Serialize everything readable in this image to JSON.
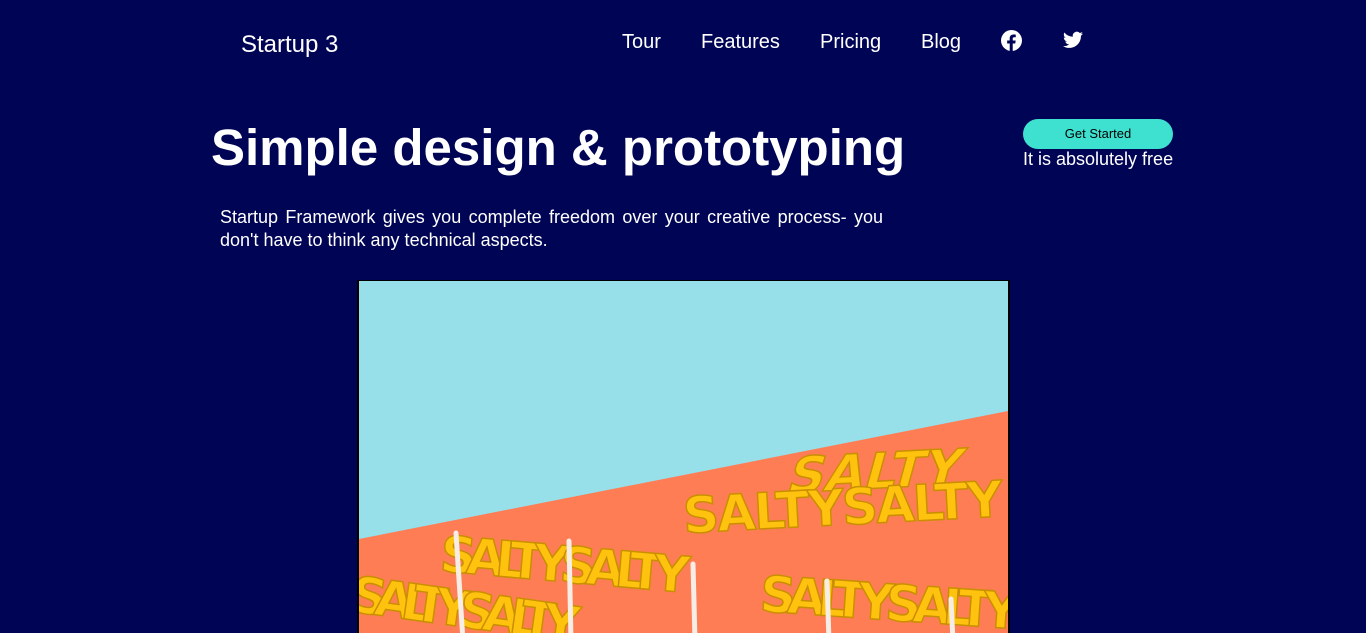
{
  "brand": {
    "name": "Startup 3"
  },
  "nav": {
    "links": [
      {
        "label": "Tour"
      },
      {
        "label": "Features"
      },
      {
        "label": "Pricing"
      },
      {
        "label": "Blog"
      }
    ],
    "icons": [
      "facebook-icon",
      "twitter-icon"
    ]
  },
  "hero": {
    "title": "Simple design & prototyping",
    "description": "Startup Framework gives you complete freedom over your creative process- you don't have to think any technical aspects.",
    "cta_label": "Get Started",
    "cta_note": "It is absolutely free",
    "image": {
      "sign_text": "SALTY",
      "colors": {
        "sky": "#97e0ea",
        "wall": "#ff7d55",
        "letters": "#ffc20e"
      }
    }
  },
  "colors": {
    "background": "#000454",
    "accent": "#3ee0cf",
    "text": "#ffffff"
  }
}
